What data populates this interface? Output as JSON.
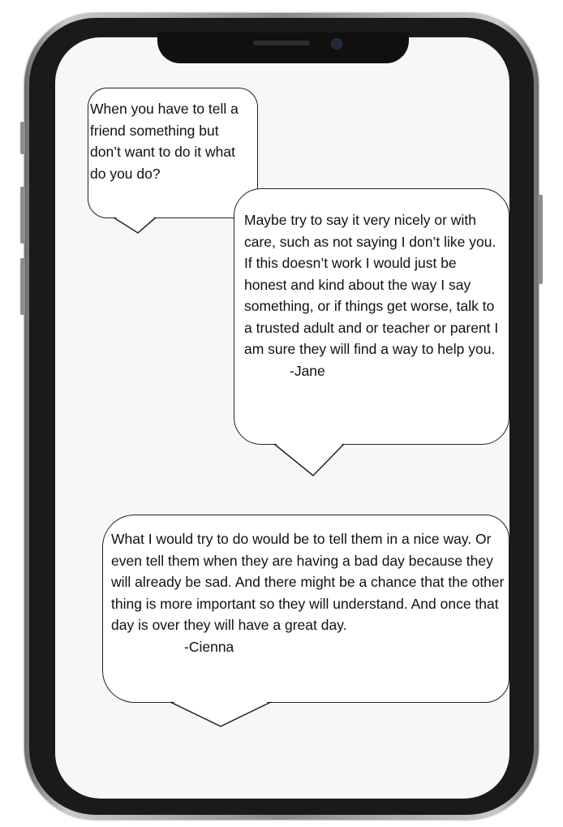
{
  "bubbles": {
    "question": {
      "text": "When you have to tell a friend something but don’t want to do it what do you do?"
    },
    "reply_jane": {
      "text": "Maybe try to say it very nicely or with care, such as not saying I don’t like you. If this doesn’t work I would just be honest and kind about the way I say something, or if things get worse, talk to a trusted adult and or teacher or parent I am sure they will find a way to help you.",
      "signature": "-Jane"
    },
    "reply_cienna": {
      "text": " What I would try to do would be to tell them in a nice way. Or even tell them when they are having a bad day because they will already be sad. And there might be a chance that the other thing is more important so they will understand. And once that day is over they will have a great day.",
      "signature": "-Cienna"
    }
  },
  "colors": {
    "screen": "#f7f7f7",
    "bubble_fill": "#ffffff",
    "bubble_border": "#222222",
    "phone_frame": "#1a1a1a"
  }
}
